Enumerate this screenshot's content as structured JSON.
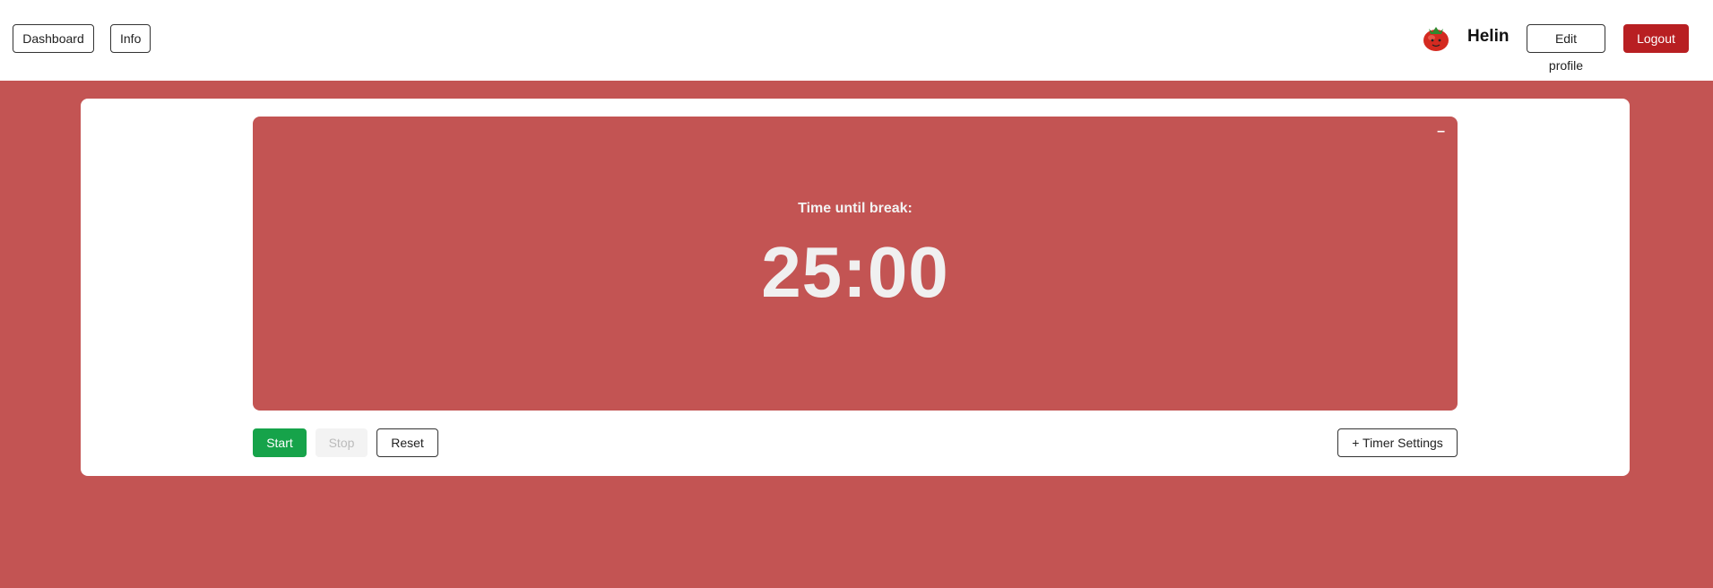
{
  "nav": {
    "dashboard_label": "Dashboard",
    "info_label": "Info"
  },
  "user": {
    "name": "Helin",
    "avatar_icon": "tomato-icon",
    "edit_label": "Edit profile",
    "logout_label": "Logout"
  },
  "timer": {
    "minimize_label": "–",
    "label": "Time until break:",
    "value": "25:00"
  },
  "controls": {
    "start_label": "Start",
    "stop_label": "Stop",
    "reset_label": "Reset",
    "settings_label": "+ Timer Settings"
  },
  "colors": {
    "background": "#c35453",
    "start": "#16a34a",
    "logout": "#b81f22"
  }
}
